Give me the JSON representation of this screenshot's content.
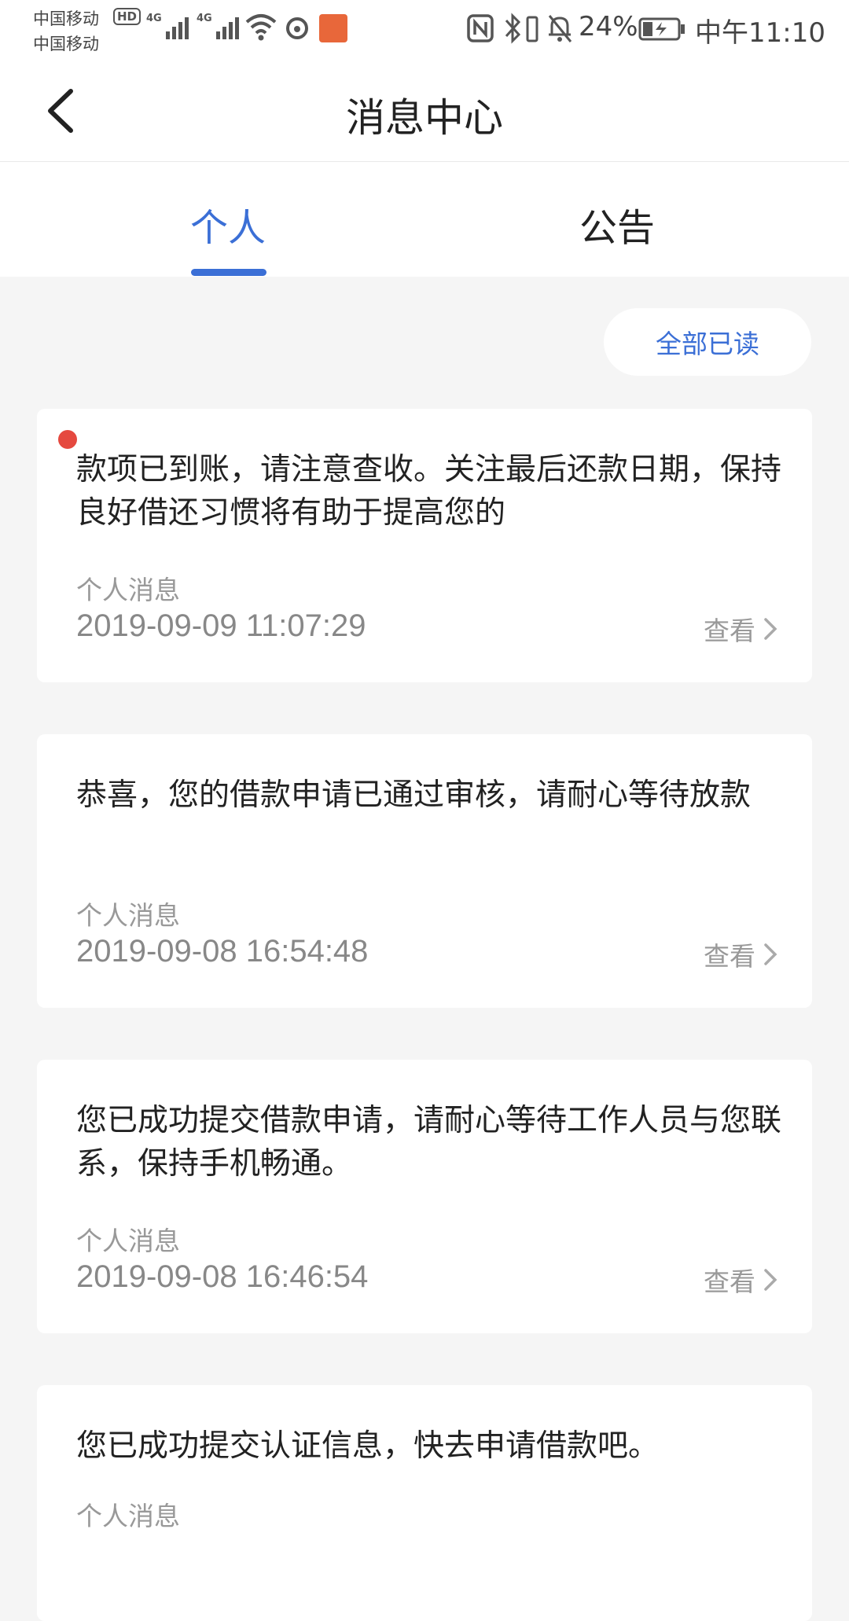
{
  "status_bar": {
    "carrier1": "中国移动",
    "carrier2": "中国移动",
    "hd_label": "HD",
    "network1": "4G",
    "network2": "4G",
    "battery_percent": "24%",
    "time": "中午11:10"
  },
  "header": {
    "title": "消息中心"
  },
  "tabs": [
    {
      "label": "个人",
      "active": true
    },
    {
      "label": "公告",
      "active": false
    }
  ],
  "mark_all_read_label": "全部已读",
  "colors": {
    "accent": "#3b6fd6",
    "unread": "#e5493f"
  },
  "messages": [
    {
      "body": "款项已到账，请注意查收。关注最后还款日期，保持良好借还习惯将有助于提高您的",
      "category": "个人消息",
      "time": "2019-09-09 11:07:29",
      "action": "查看",
      "unread": true
    },
    {
      "body": "恭喜，您的借款申请已通过审核，请耐心等待放款",
      "category": "个人消息",
      "time": "2019-09-08 16:54:48",
      "action": "查看",
      "unread": false
    },
    {
      "body": "您已成功提交借款申请，请耐心等待工作人员与您联系，保持手机畅通。",
      "category": "个人消息",
      "time": "2019-09-08 16:46:54",
      "action": "查看",
      "unread": false
    },
    {
      "body": "您已成功提交认证信息，快去申请借款吧。",
      "category": "个人消息",
      "time": "",
      "action": "",
      "unread": false
    }
  ]
}
